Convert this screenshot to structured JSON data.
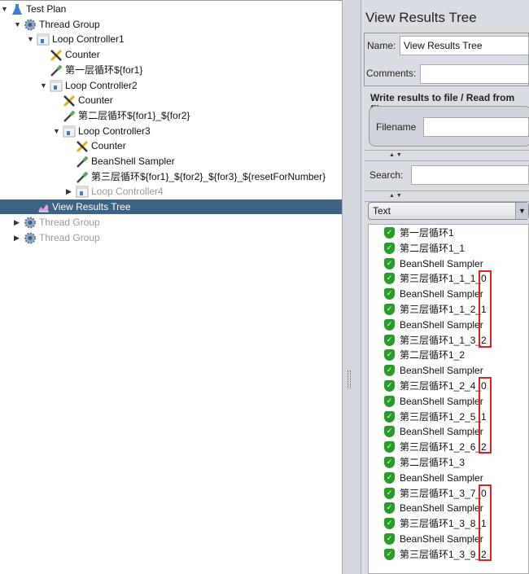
{
  "tree": [
    {
      "label": "Test Plan",
      "level": 0,
      "arrow": "expanded",
      "icon": "flask-icon"
    },
    {
      "label": "Thread Group",
      "level": 1,
      "arrow": "expanded",
      "icon": "gear-icon"
    },
    {
      "label": "Loop Controller1",
      "level": 2,
      "arrow": "expanded",
      "icon": "loop-controller-icon"
    },
    {
      "label": "Counter",
      "level": 3,
      "arrow": "none",
      "icon": "wrench-icon"
    },
    {
      "label": "第一层循环${for1}",
      "level": 3,
      "arrow": "none",
      "icon": "dropper-icon"
    },
    {
      "label": "Loop Controller2",
      "level": 3,
      "arrow": "expanded",
      "icon": "loop-controller-icon"
    },
    {
      "label": "Counter",
      "level": 4,
      "arrow": "none",
      "icon": "wrench-icon"
    },
    {
      "label": "第二层循环${for1}_${for2}",
      "level": 4,
      "arrow": "none",
      "icon": "dropper-icon"
    },
    {
      "label": "Loop Controller3",
      "level": 4,
      "arrow": "expanded",
      "icon": "loop-controller-icon"
    },
    {
      "label": "Counter",
      "level": 5,
      "arrow": "none",
      "icon": "wrench-icon"
    },
    {
      "label": "BeanShell Sampler",
      "level": 5,
      "arrow": "none",
      "icon": "dropper-icon"
    },
    {
      "label": "第三层循环${for1}_${for2}_${for3}_${resetForNumber}",
      "level": 5,
      "arrow": "none",
      "icon": "dropper-icon"
    },
    {
      "label": "Loop Controller4",
      "level": 5,
      "arrow": "collapsed",
      "icon": "loop-controller-icon",
      "disabled": true
    },
    {
      "label": "View Results Tree",
      "level": 2,
      "arrow": "none",
      "icon": "chart-listener-icon",
      "selected": true
    },
    {
      "label": "Thread Group",
      "level": 1,
      "arrow": "collapsed",
      "icon": "gear-icon",
      "disabled": true
    },
    {
      "label": "Thread Group",
      "level": 1,
      "arrow": "collapsed",
      "icon": "gear-icon",
      "disabled": true
    }
  ],
  "panel": {
    "title": "View Results Tree",
    "name_label": "Name:",
    "name_value": "View Results Tree",
    "comments_label": "Comments:",
    "comments_value": "",
    "file_section": "Write results to file / Read from file",
    "filename_label": "Filename",
    "filename_value": "",
    "search_label": "Search:",
    "search_value": "",
    "renderer": "Text"
  },
  "results": [
    "第一层循环1",
    "第二层循环1_1",
    "BeanShell Sampler",
    "第三层循环1_1_1_0",
    "BeanShell Sampler",
    "第三层循环1_1_2_1",
    "BeanShell Sampler",
    "第三层循环1_1_3_2",
    "第二层循环1_2",
    "BeanShell Sampler",
    "第三层循环1_2_4_0",
    "BeanShell Sampler",
    "第三层循环1_2_5_1",
    "BeanShell Sampler",
    "第三层循环1_2_6_2",
    "第二层循环1_3",
    "BeanShell Sampler",
    "第三层循环1_3_7_0",
    "BeanShell Sampler",
    "第三层循环1_3_8_1",
    "BeanShell Sampler",
    "第三层循环1_3_9_2"
  ],
  "colors": {
    "selection": "#3c6286",
    "success": "#2a9b2a",
    "highlight_box": "#dd2222"
  }
}
